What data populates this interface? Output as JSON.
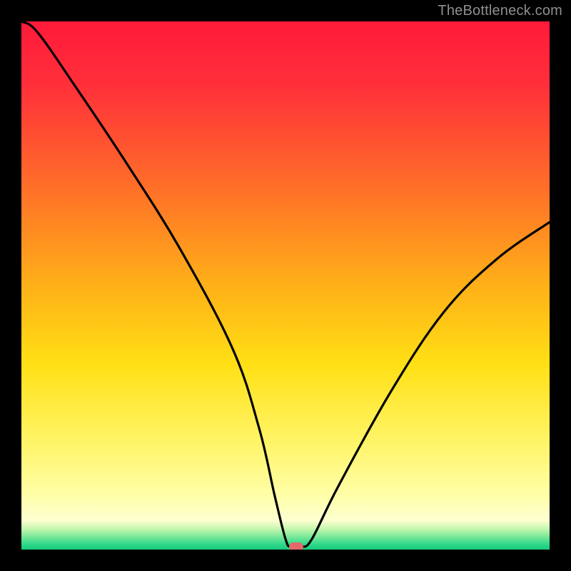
{
  "watermark": "TheBottleneck.com",
  "chart_data": {
    "type": "line",
    "title": "",
    "xlabel": "",
    "ylabel": "",
    "xlim": [
      0,
      100
    ],
    "ylim": [
      0,
      100
    ],
    "x": [
      0,
      3,
      10,
      20,
      30,
      40,
      45,
      48,
      50,
      51,
      53,
      55,
      60,
      70,
      80,
      90,
      100
    ],
    "values": [
      100,
      98,
      88,
      73,
      57,
      38,
      23,
      10,
      2,
      0.5,
      0.5,
      2,
      12,
      30,
      45,
      55,
      62
    ],
    "minimum_marker": {
      "x": 52,
      "y": 0.5
    },
    "gradient_stops": [
      {
        "pos": 0.0,
        "color": "#ff1a3a"
      },
      {
        "pos": 0.12,
        "color": "#ff2f3a"
      },
      {
        "pos": 0.3,
        "color": "#ff6a2a"
      },
      {
        "pos": 0.5,
        "color": "#ffb018"
      },
      {
        "pos": 0.65,
        "color": "#ffe015"
      },
      {
        "pos": 0.8,
        "color": "#fff56a"
      },
      {
        "pos": 0.9,
        "color": "#ffffaa"
      },
      {
        "pos": 0.945,
        "color": "#fdffd0"
      },
      {
        "pos": 0.96,
        "color": "#c8f7b0"
      },
      {
        "pos": 0.975,
        "color": "#7de89a"
      },
      {
        "pos": 0.99,
        "color": "#2fd98b"
      },
      {
        "pos": 1.0,
        "color": "#18c87a"
      }
    ],
    "marker_color": "#e46a6a",
    "curve_color": "#000000"
  }
}
